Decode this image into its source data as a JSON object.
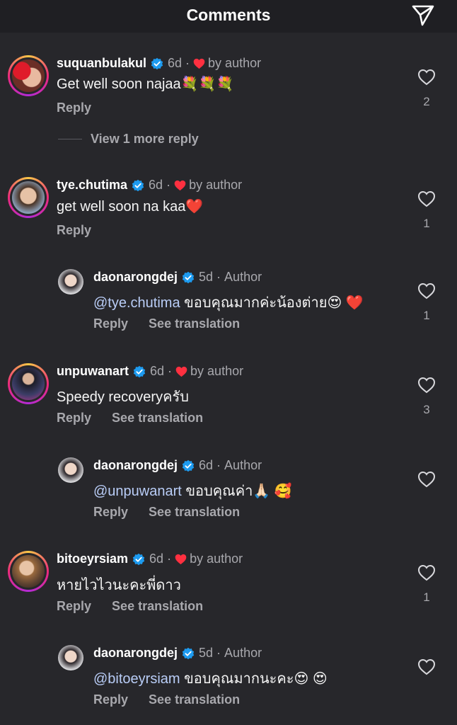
{
  "header": {
    "title": "Comments",
    "send_icon": "send-icon"
  },
  "colors": {
    "background": "#27272b",
    "verified": "#1d9bf0",
    "heart_red": "#ff3040",
    "mention": "#b9cdf7"
  },
  "comments": [
    {
      "username": "suquanbulakul",
      "time": "6d",
      "badge": "by author",
      "text": "Get well soon najaa💐💐💐",
      "reply": "Reply",
      "likes": "2",
      "view_more": "View 1 more reply"
    },
    {
      "username": "tye.chutima",
      "time": "6d",
      "badge": "by author",
      "text": "get well soon na kaa❤️",
      "reply": "Reply",
      "likes": "1"
    },
    {
      "username": "daonarongdej",
      "time": "5d",
      "badge": "Author",
      "mention": "@tye.chutima",
      "text": " ขอบคุณมากค่ะน้องต่าย😍 ❤️",
      "reply": "Reply",
      "see_translation": "See translation",
      "likes": "1"
    },
    {
      "username": "unpuwanart",
      "time": "6d",
      "badge": "by author",
      "text": "Speedy recoveryครับ",
      "reply": "Reply",
      "see_translation": "See translation",
      "likes": "3"
    },
    {
      "username": "daonarongdej",
      "time": "6d",
      "badge": "Author",
      "mention": "@unpuwanart",
      "text": " ขอบคุณค่า🙏🏻 🥰",
      "reply": "Reply",
      "see_translation": "See translation",
      "likes": ""
    },
    {
      "username": "bitoeyrsiam",
      "time": "6d",
      "badge": "by author",
      "text": "หายไวไวนะคะพี่ดาว",
      "reply": "Reply",
      "see_translation": "See translation",
      "likes": "1"
    },
    {
      "username": "daonarongdej",
      "time": "5d",
      "badge": "Author",
      "mention": "@bitoeyrsiam",
      "text": " ขอบคุณมากนะคะ😍 😍",
      "reply": "Reply",
      "see_translation": "See translation",
      "likes": ""
    }
  ]
}
